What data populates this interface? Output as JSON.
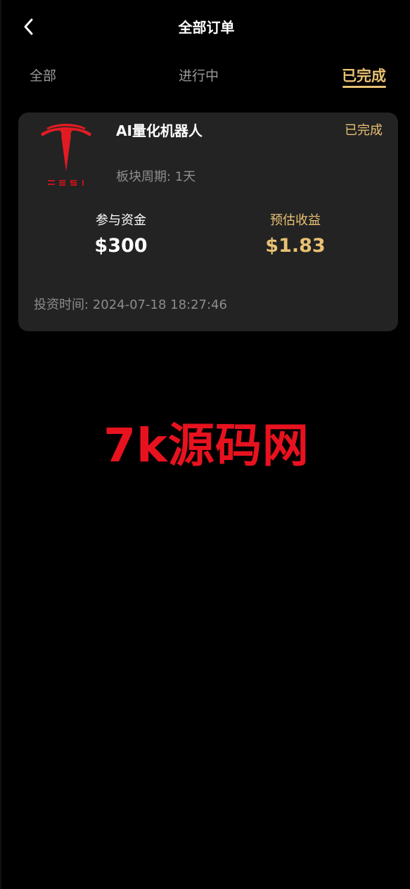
{
  "header": {
    "title": "全部订单",
    "back_icon": "chevron-left-icon"
  },
  "tabs": [
    {
      "label": "全部",
      "active": false
    },
    {
      "label": "进行中",
      "active": false
    },
    {
      "label": "已完成",
      "active": true
    }
  ],
  "order": {
    "logo_icon": "tesla-logo",
    "product_name": "AI量化机器人",
    "status": "已完成",
    "period": "板块周期: 1天",
    "capital_label": "参与资金",
    "capital_value": "$300",
    "profit_label": "预估收益",
    "profit_value": "$1.83",
    "invest_time": "投资时间: 2024-07-18 18:27:46"
  },
  "watermark": "7k源码网",
  "colors": {
    "background": "#000000",
    "card": "#232323",
    "accent_gold": "#e8c173",
    "brand_red": "#e8121f",
    "muted_text": "#8c8c8c"
  }
}
